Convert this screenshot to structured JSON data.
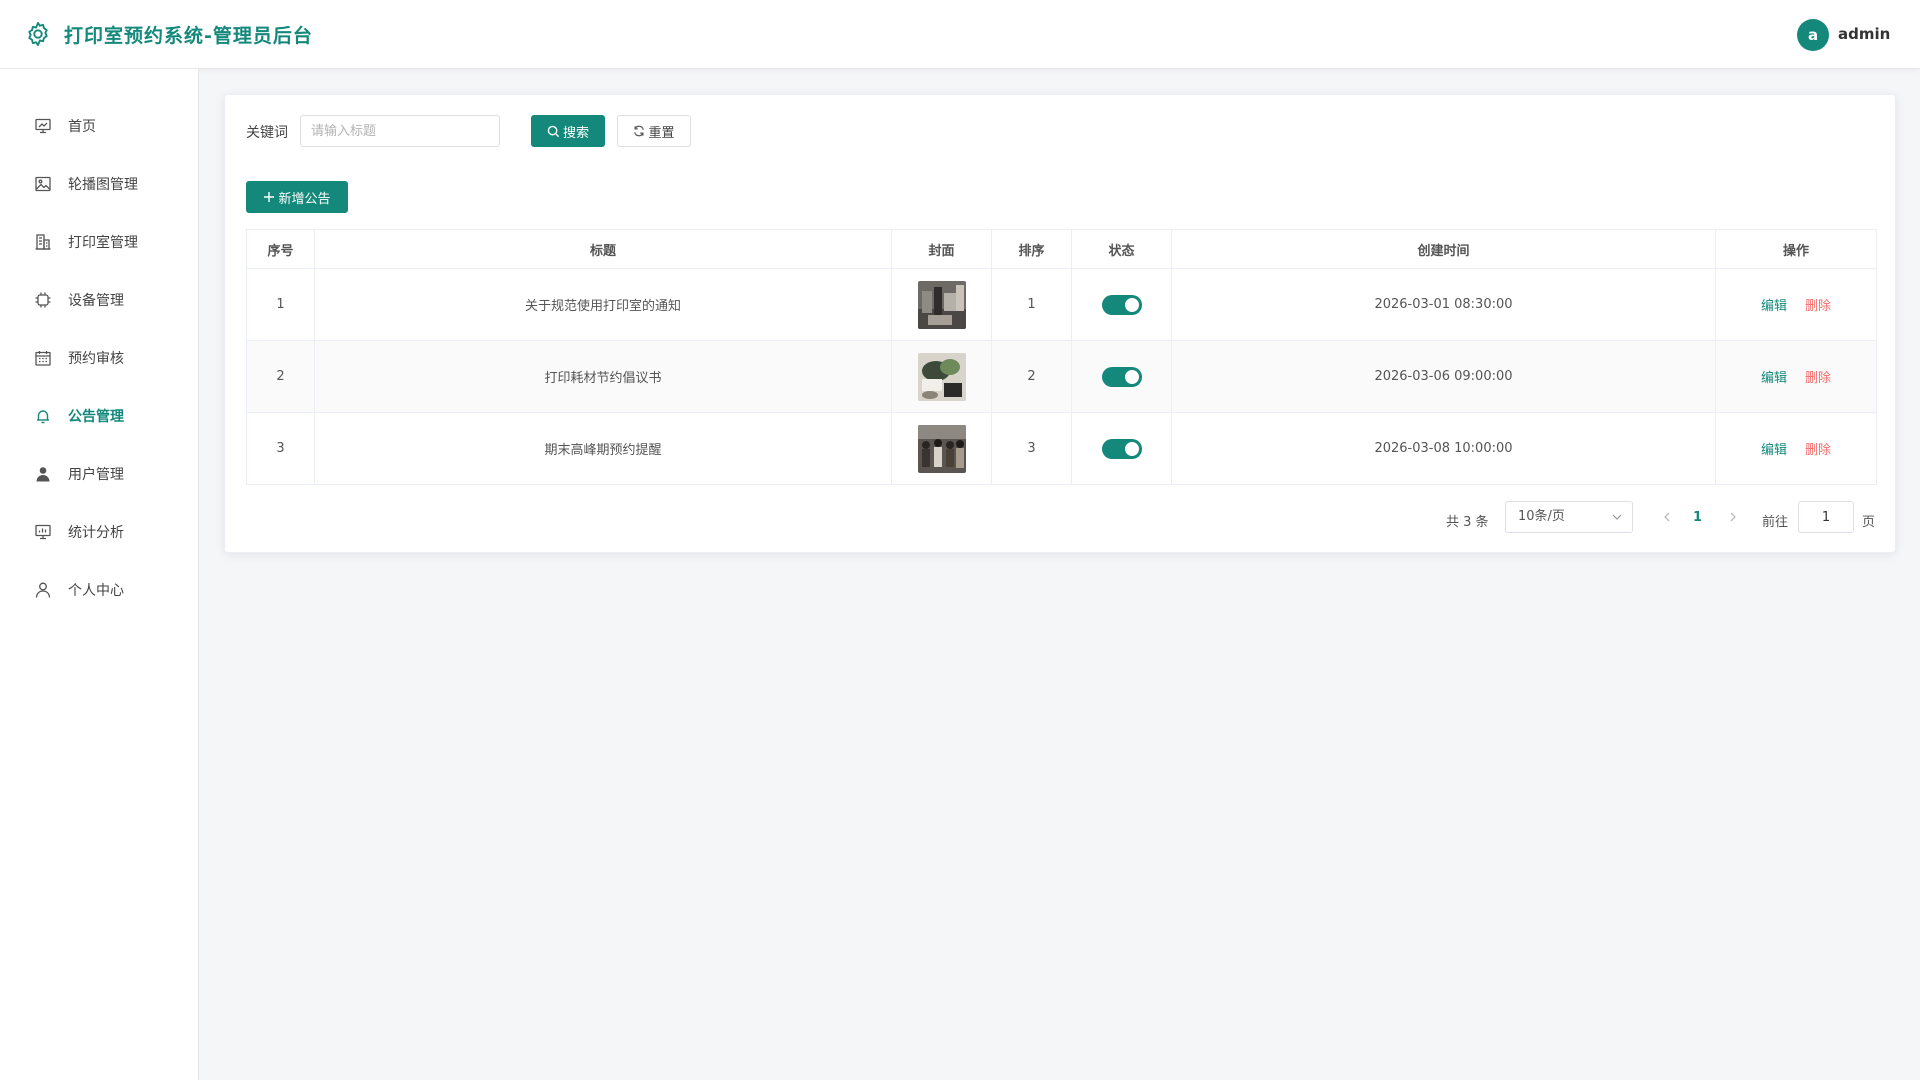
{
  "header": {
    "title": "打印室预约系统-管理员后台",
    "avatar_letter": "a",
    "username": "admin"
  },
  "sidebar": {
    "items": [
      {
        "label": "首页",
        "icon": "dashboard-icon"
      },
      {
        "label": "轮播图管理",
        "icon": "image-icon"
      },
      {
        "label": "打印室管理",
        "icon": "building-icon"
      },
      {
        "label": "设备管理",
        "icon": "chip-icon"
      },
      {
        "label": "预约审核",
        "icon": "calendar-icon"
      },
      {
        "label": "公告管理",
        "icon": "bell-icon",
        "active": true
      },
      {
        "label": "用户管理",
        "icon": "user-filled-icon"
      },
      {
        "label": "统计分析",
        "icon": "chart-board-icon"
      },
      {
        "label": "个人中心",
        "icon": "user-outline-icon"
      }
    ]
  },
  "search": {
    "label": "关键词",
    "placeholder": "请输入标题",
    "value": "",
    "search_button": "搜索",
    "reset_button": "重置"
  },
  "toolbar": {
    "add_button": "新增公告"
  },
  "table": {
    "headers": [
      "序号",
      "标题",
      "封面",
      "排序",
      "状态",
      "创建时间",
      "操作"
    ],
    "rows": [
      {
        "index": "1",
        "title": "关于规范使用打印室的通知",
        "sort": "1",
        "status": true,
        "created": "2026-03-01 08:30:00"
      },
      {
        "index": "2",
        "title": "打印耗材节约倡议书",
        "sort": "2",
        "status": true,
        "created": "2026-03-06 09:00:00"
      },
      {
        "index": "3",
        "title": "期末高峰期预约提醒",
        "sort": "3",
        "status": true,
        "created": "2026-03-08 10:00:00"
      }
    ],
    "edit_label": "编辑",
    "delete_label": "删除"
  },
  "pagination": {
    "total_text": "共 3 条",
    "page_size": "10条/页",
    "current_page": "1",
    "goto_label": "前往",
    "goto_value": "1",
    "goto_suffix": "页"
  },
  "colors": {
    "primary": "#14897b",
    "danger": "#f56c6c"
  }
}
